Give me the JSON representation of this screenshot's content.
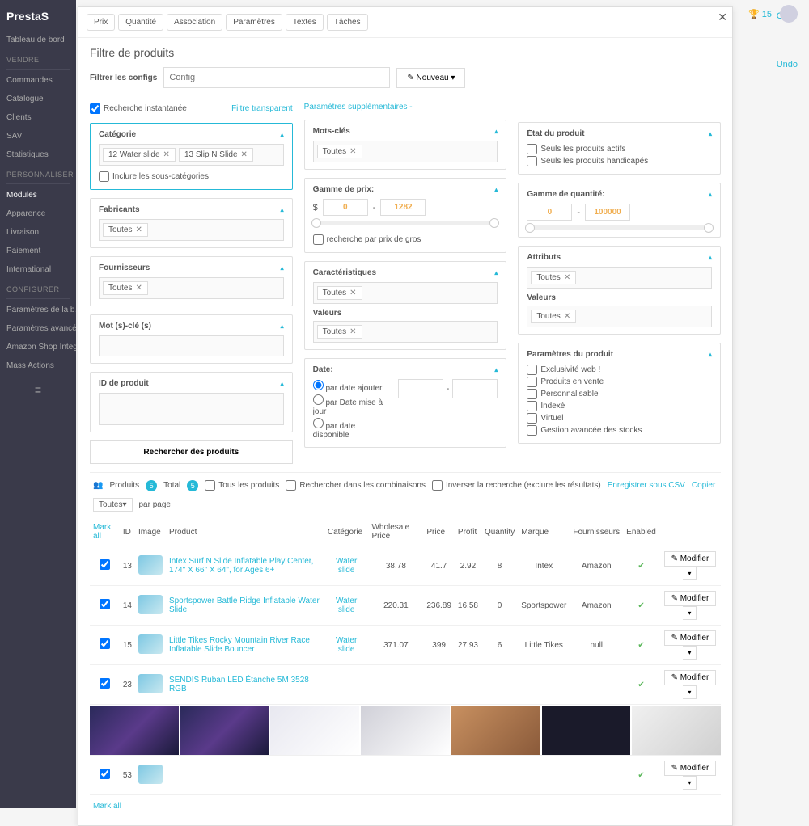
{
  "brand": "PrestaS",
  "topbar": {
    "trophy": "🏆 15"
  },
  "sidebar": {
    "dashboard": "Tableau de bord",
    "sec_vendre": "VENDRE",
    "items_vendre": [
      "Commandes",
      "Catalogue",
      "Clients",
      "SAV",
      "Statistiques"
    ],
    "sec_personnaliser": "PERSONNALISER",
    "items_pers": [
      "Modules",
      "Apparence",
      "Livraison",
      "Paiement",
      "International"
    ],
    "sec_configurer": "CONFIGURER",
    "items_conf": [
      "Paramètres de la b…",
      "Paramètres avancé…",
      "Amazon Shop Integ…",
      "Mass Actions"
    ]
  },
  "right": {
    "clear": "Clear",
    "undo": "Undo"
  },
  "modal": {
    "title": "Filtre de produits",
    "tabs": [
      "Prix",
      "Quantité",
      "Association",
      "Paramètres",
      "Textes",
      "Tâches"
    ],
    "config": {
      "label": "Filtrer les configs",
      "placeholder": "Config",
      "nouveau": "Nouveau"
    },
    "col1": {
      "instant": "Recherche instantanée",
      "transparent": "Filtre transparent",
      "categorie": {
        "title": "Catégorie",
        "tags": [
          "12 Water slide",
          "13 Slip N Slide"
        ],
        "sub": "Inclure les sous-catégories"
      },
      "fabricants": {
        "title": "Fabricants",
        "tag": "Toutes"
      },
      "fournisseurs": {
        "title": "Fournisseurs",
        "tag": "Toutes"
      },
      "motcle": {
        "title": "Mot (s)-clé (s)"
      },
      "idprod": {
        "title": "ID de produit"
      },
      "search": "Rechercher des produits"
    },
    "col2": {
      "extra": "Paramètres supplémentaires -",
      "motcles": {
        "title": "Mots-clés",
        "tag": "Toutes"
      },
      "prix": {
        "title": "Gamme de prix:",
        "min": "0",
        "max": "1282",
        "currency": "$",
        "gros": "recherche par prix de gros"
      },
      "carac": {
        "title": "Caractéristiques",
        "tag": "Toutes"
      },
      "valeurs": {
        "title": "Valeurs",
        "tag": "Toutes"
      },
      "date": {
        "title": "Date:",
        "opts": [
          "par date ajouter",
          "par Date mise à jour",
          "par date disponible"
        ]
      }
    },
    "col3": {
      "etat": {
        "title": "État du produit",
        "opts": [
          "Seuls les produits actifs",
          "Seuls les produits handicapés"
        ]
      },
      "qty": {
        "title": "Gamme de quantité:",
        "min": "0",
        "max": "100000"
      },
      "attr": {
        "title": "Attributs",
        "tag": "Toutes"
      },
      "valeurs": {
        "title": "Valeurs",
        "tag": "Toutes"
      },
      "params": {
        "title": "Paramètres du produit",
        "opts": [
          "Exclusivité web !",
          "Produits en vente",
          "Personnalisable",
          "Indexé",
          "Virtuel",
          "Gestion avancée des stocks"
        ]
      }
    },
    "results": {
      "produits": "Produits",
      "total": "Total",
      "count": "5",
      "allprod": "Tous les produits",
      "combi": "Rechercher dans les combinaisons",
      "inverse": "Inverser la recherche (exclure les résultats)",
      "csv": "Enregistrer sous CSV",
      "copy": "Copier",
      "perpage": "Toutes",
      "perpage_label": "par page",
      "markall": "Mark all",
      "headers": [
        "ID",
        "Image",
        "Product",
        "Catégorie",
        "Wholesale Price",
        "Price",
        "Profit",
        "Quantity",
        "Marque",
        "Fournisseurs",
        "Enabled",
        ""
      ],
      "rows": [
        {
          "id": "13",
          "product": "Intex Surf N Slide Inflatable Play Center, 174\" X 66\" X 64\", for Ages 6+",
          "cat": "Water slide",
          "wp": "38.78",
          "price": "41.7",
          "profit": "2.92",
          "qty": "8",
          "marque": "Intex",
          "four": "Amazon"
        },
        {
          "id": "14",
          "product": "Sportspower Battle Ridge Inflatable Water Slide",
          "cat": "Water slide",
          "wp": "220.31",
          "price": "236.89",
          "profit": "16.58",
          "qty": "0",
          "marque": "Sportspower",
          "four": "Amazon"
        },
        {
          "id": "15",
          "product": "Little Tikes Rocky Mountain River Race Inflatable Slide Bouncer",
          "cat": "Water slide",
          "wp": "371.07",
          "price": "399",
          "profit": "27.93",
          "qty": "6",
          "marque": "Little Tikes",
          "four": "null"
        },
        {
          "id": "23",
          "product": "SENDIS Ruban LED Étanche 5M 3528 RGB"
        },
        {
          "id": "53",
          "product": ""
        }
      ],
      "modifier": "Modifier"
    }
  }
}
